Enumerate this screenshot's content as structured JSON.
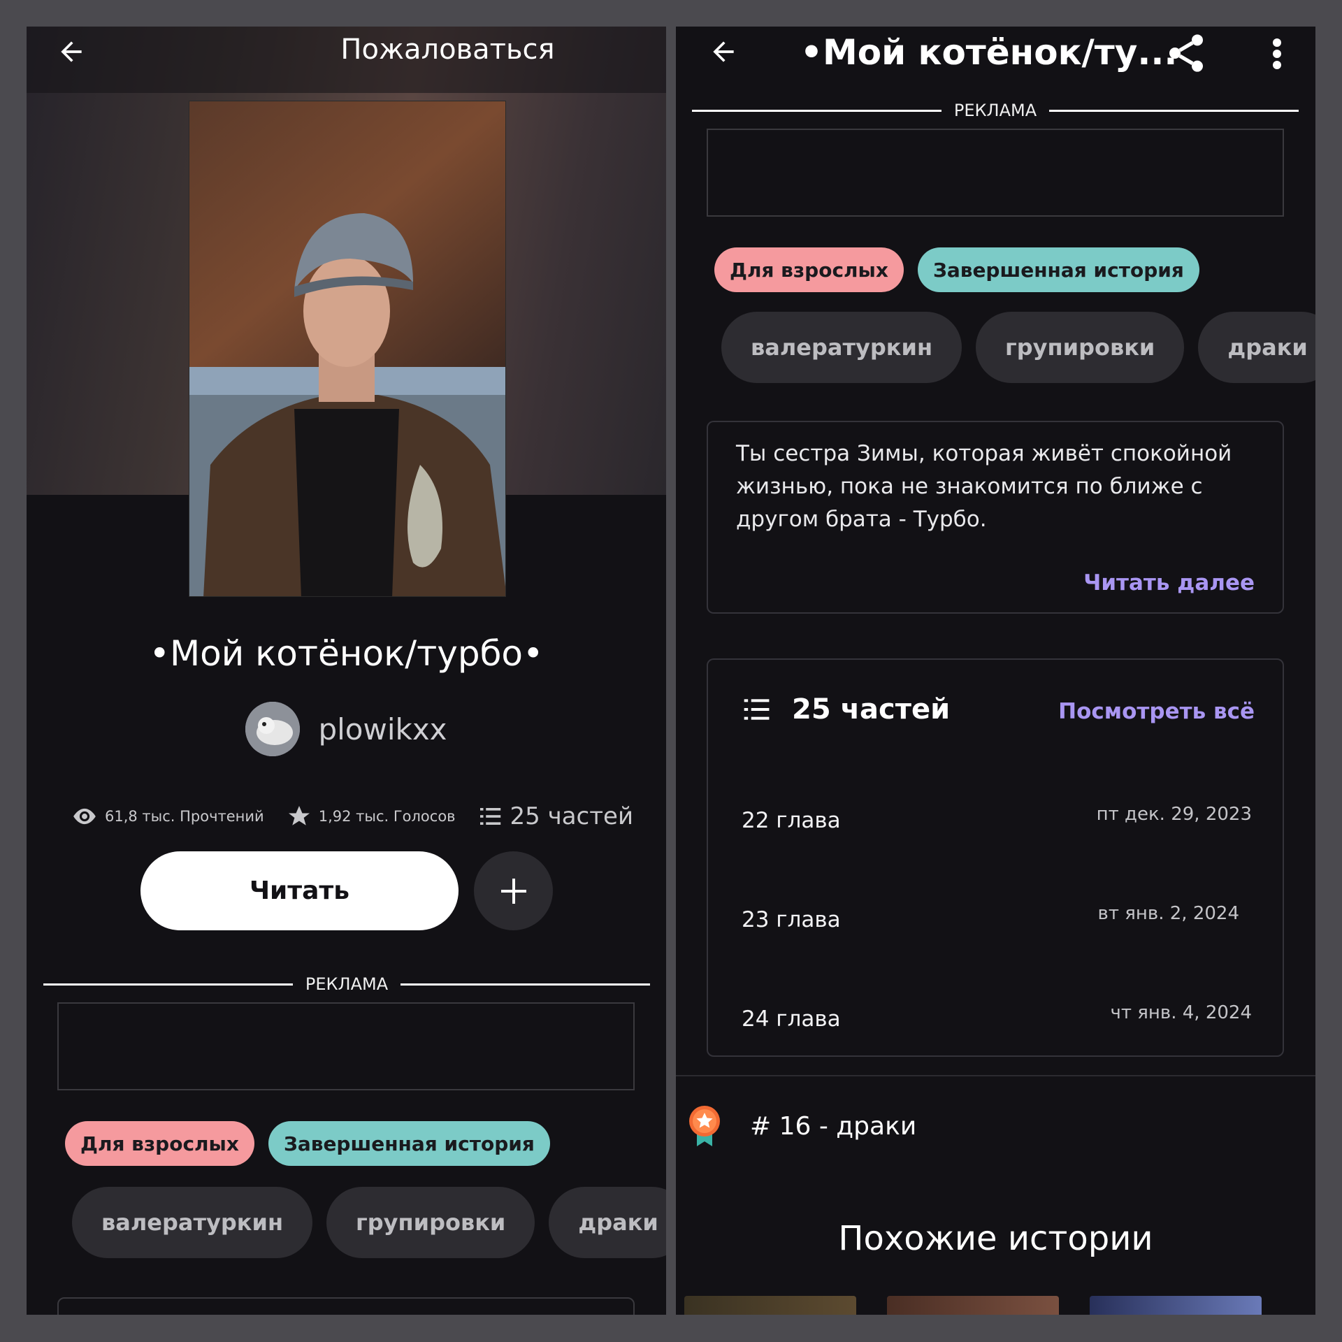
{
  "left": {
    "topbar": {
      "report_label": "Пожаловаться"
    },
    "story": {
      "title": "•Мой котёнок/турбо•",
      "author": "plowikxx"
    },
    "stats": {
      "reads": "61,8 тыс. Прочтений",
      "votes": "1,92 тыс. Голосов",
      "parts": "25 частей"
    },
    "actions": {
      "read_label": "Читать"
    },
    "ad": {
      "label": "РЕКЛАМА"
    },
    "tags": {
      "adult": "Для взрослых",
      "complete": "Завершенная история"
    },
    "chips": [
      "валературкин",
      "групировки",
      "драки"
    ]
  },
  "right": {
    "topbar": {
      "title": "•Мой котёнок/ту..."
    },
    "ad": {
      "label": "РЕКЛАМА"
    },
    "tags": {
      "adult": "Для взрослых",
      "complete": "Завершенная история"
    },
    "chips": [
      "валературкин",
      "групировки",
      "драки"
    ],
    "description": {
      "text": "Ты сестра Зимы, которая живёт спокойной жизнью, пока не знакомится по ближе с другом брата - Турбо.",
      "read_more": "Читать далее"
    },
    "parts": {
      "count_label": "25 частей",
      "see_all": "Посмотреть всё",
      "chapters": [
        {
          "title": "22 глава",
          "date": "пт дек. 29, 2023"
        },
        {
          "title": "23 глава",
          "date": "вт янв. 2, 2024"
        },
        {
          "title": "24 глава",
          "date": "чт янв. 4, 2024"
        }
      ]
    },
    "ranking": {
      "text": "# 16 - драки"
    },
    "similar": {
      "title": "Похожие истории"
    }
  },
  "colors": {
    "background": "#121115",
    "frame": "#4b4a4f",
    "accent_link": "#a996f2",
    "tag_adult": "#f59a9e",
    "tag_complete": "#7ccbc7",
    "chip": "#2d2c31"
  },
  "icons": [
    "back-arrow-icon",
    "share-icon",
    "more-vert-icon",
    "eye-icon",
    "star-icon",
    "list-icon",
    "plus-icon",
    "award-badge-icon"
  ]
}
